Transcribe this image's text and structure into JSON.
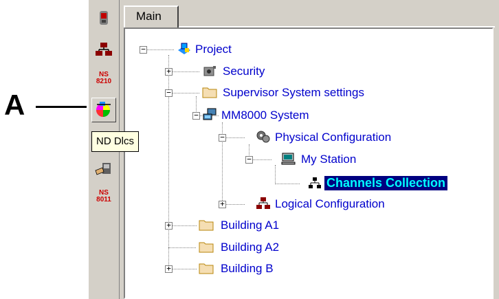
{
  "callout": {
    "letter": "A"
  },
  "toolbar": {
    "label_ns8210": "NS\n8210",
    "label_ns8011": "NS\n8011"
  },
  "tooltip": {
    "text": "ND Dlcs"
  },
  "tabs": [
    {
      "label": "Main"
    }
  ],
  "tree": {
    "project": "Project",
    "security": "Security",
    "supervisor": "Supervisor System settings",
    "mm8000": "MM8000 System",
    "physical": "Physical Configuration",
    "my_station": "My Station",
    "channels": "Channels Collection",
    "logical": "Logical Configuration",
    "building_a1": "Building A1",
    "building_a2": "Building A2",
    "building_b": "Building B"
  },
  "expanders": {
    "collapsed": "+",
    "expanded": "−"
  },
  "colors": {
    "link": "#0000cc",
    "selection_bg": "#000080",
    "selection_fg": "#00ffff",
    "toolbar_label": "#cc0000"
  }
}
